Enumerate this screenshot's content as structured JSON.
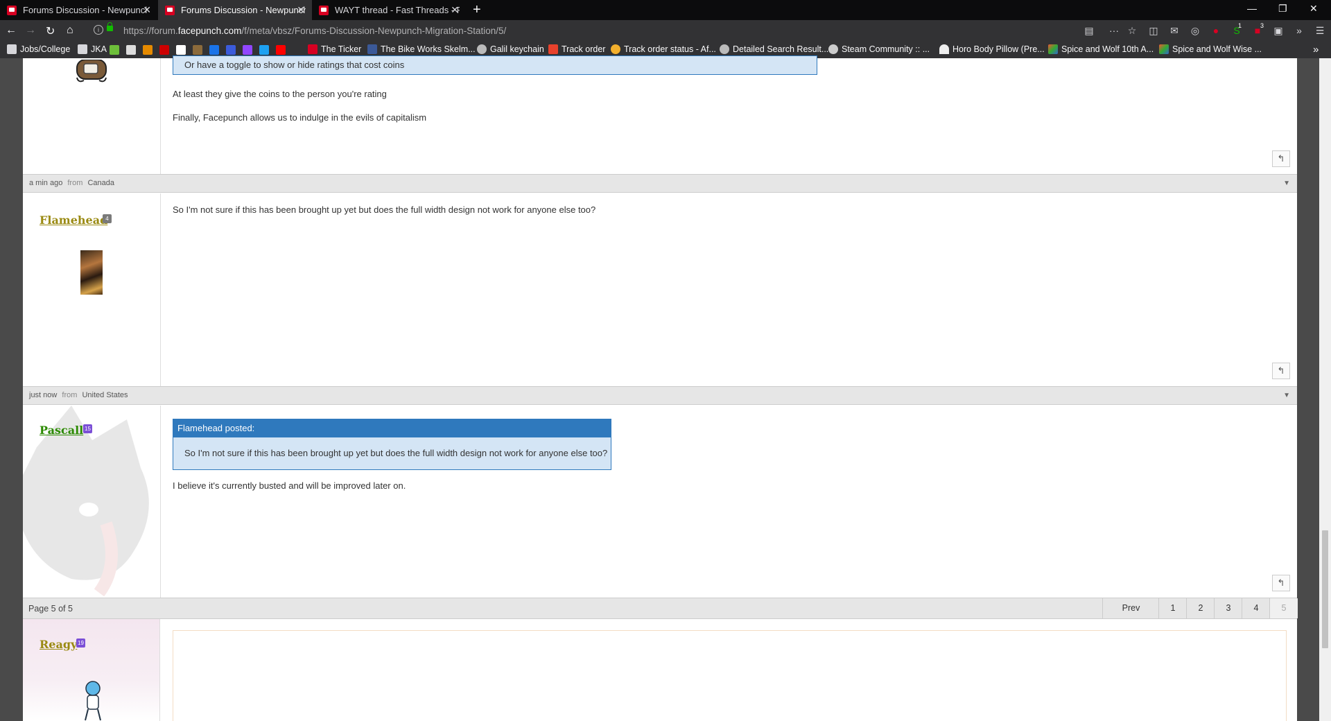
{
  "browser": {
    "tabs": [
      {
        "title": "Forums Discussion - Newpunch",
        "active": false
      },
      {
        "title": "Forums Discussion - Newpunch",
        "active": true
      },
      {
        "title": "WAYT thread - Fast Threads - F",
        "active": false
      }
    ],
    "url_prefix": "https://forum.",
    "url_host": "facepunch.com",
    "url_path": "/f/meta/vbsz/Forums-Discussion-Newpunch-Migration-Station/5/",
    "toolbar_badges": {
      "sync_count": "1",
      "ext_count": "3"
    },
    "bookmarks": [
      {
        "label": "Jobs/College",
        "icon": "folder-icon"
      },
      {
        "label": "JKA",
        "icon": "folder-icon"
      },
      {
        "label": "The Ticker",
        "icon": "ticker-icon"
      },
      {
        "label": "The Bike Works Skelm...",
        "icon": "facebook-icon"
      },
      {
        "label": "Galil keychain",
        "icon": "globe-icon"
      },
      {
        "label": "Track order",
        "icon": "track-order-icon"
      },
      {
        "label": "Track order status - Af...",
        "icon": "aliexpress-icon"
      },
      {
        "label": "Detailed Search Result...",
        "icon": "globe-icon"
      },
      {
        "label": "Steam Community :: ...",
        "icon": "steam-icon"
      },
      {
        "label": "Horo Body Pillow (Pre...",
        "icon": "umbrella-icon"
      },
      {
        "label": "Spice and Wolf 10th A...",
        "icon": "xbox-icon"
      },
      {
        "label": "Spice and Wolf Wise ...",
        "icon": "xbox-icon"
      }
    ]
  },
  "posts": [
    {
      "quote_fragment": "Or have a toggle to show or hide ratings that cost coins",
      "paragraphs": [
        "At least they give the coins to the person you're rating",
        "Finally, Facepunch allows us to indulge in the evils of capitalism"
      ],
      "reply_icon": "reply-arrow-icon"
    },
    {
      "meta_time": "a min ago",
      "meta_from_word": "from",
      "meta_country": "Canada",
      "username": "Flamehead",
      "badge": "4",
      "username_color": "#9a8a12",
      "badge_color": "#7a7a7a",
      "paragraphs": [
        "So I'm not sure if this has been brought up yet but does the full width design not work for anyone else too?"
      ],
      "reply_icon": "reply-arrow-icon"
    },
    {
      "meta_time": "just now",
      "meta_from_word": "from",
      "meta_country": "United States",
      "username": "Pascall",
      "badge": "15",
      "username_color": "#2b8a00",
      "badge_color": "#7b4fd6",
      "quote_author": "Flamehead posted:",
      "quote_text": "So I'm not sure if this has been brought up yet but does the full width design not work for anyone else too?",
      "paragraphs": [
        "I believe it's currently busted and will be improved later on."
      ],
      "reply_icon": "reply-arrow-icon"
    }
  ],
  "pagination": {
    "indicator": "Page 5 of 5",
    "prev": "Prev",
    "pages": [
      "1",
      "2",
      "3",
      "4",
      "5"
    ],
    "current": "5"
  },
  "reply_user": {
    "username": "Reagy",
    "badge": "19",
    "username_color": "#9a8a12",
    "badge_color": "#7b4fd6"
  }
}
